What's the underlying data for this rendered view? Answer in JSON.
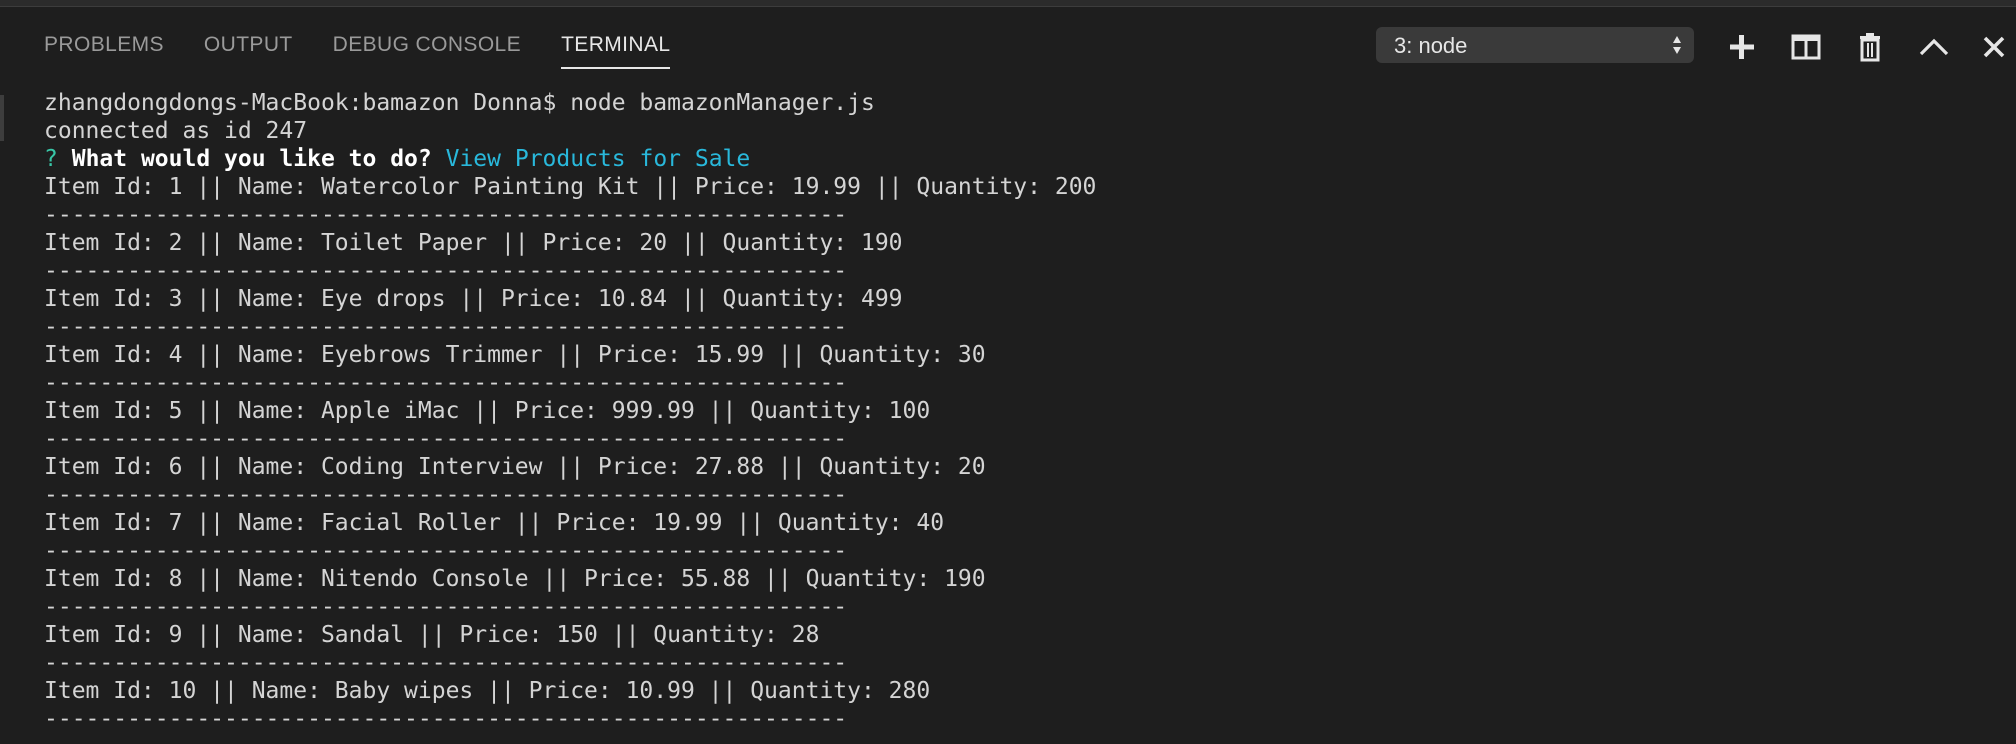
{
  "panel": {
    "tabs": [
      {
        "label": "PROBLEMS",
        "active": false
      },
      {
        "label": "OUTPUT",
        "active": false
      },
      {
        "label": "DEBUG CONSOLE",
        "active": false
      },
      {
        "label": "TERMINAL",
        "active": true
      }
    ],
    "terminal_select": {
      "value": "3: node"
    },
    "actions": [
      {
        "icon": "plus-icon",
        "label": "New Terminal"
      },
      {
        "icon": "split-icon",
        "label": "Split Terminal"
      },
      {
        "icon": "trash-icon",
        "label": "Kill Terminal"
      },
      {
        "icon": "chevron-up-icon",
        "label": "Maximize Panel"
      },
      {
        "icon": "close-icon",
        "label": "Close Panel"
      }
    ]
  },
  "terminal": {
    "prompt_line": "zhangdongdongs-MacBook:bamazon Donna$ node bamazonManager.js",
    "connected_line": "connected as id 247",
    "question": {
      "mark": "?",
      "text": "What would you like to do?",
      "answer": "View Products for Sale"
    },
    "separator": "----------------------------------------------------------",
    "items": [
      "Item Id: 1 || Name: Watercolor Painting Kit || Price: 19.99 || Quantity: 200",
      "Item Id: 2 || Name: Toilet Paper || Price: 20 || Quantity: 190",
      "Item Id: 3 || Name: Eye drops || Price: 10.84 || Quantity: 499",
      "Item Id: 4 || Name: Eyebrows Trimmer || Price: 15.99 || Quantity: 30",
      "Item Id: 5 || Name: Apple iMac || Price: 999.99 || Quantity: 100",
      "Item Id: 6 || Name: Coding Interview || Price: 27.88 || Quantity: 20",
      "Item Id: 7 || Name: Facial Roller || Price: 19.99 || Quantity: 40",
      "Item Id: 8 || Name: Nitendo Console || Price: 55.88 || Quantity: 190",
      "Item Id: 9 || Name: Sandal || Price: 150 || Quantity: 28",
      "Item Id: 10 || Name: Baby wipes || Price: 10.99 || Quantity: 280"
    ],
    "colors": {
      "background": "#1e1e1e",
      "text": "#d4d4d4",
      "question_mark": "#38c6a7",
      "answer": "#29b8db"
    }
  }
}
